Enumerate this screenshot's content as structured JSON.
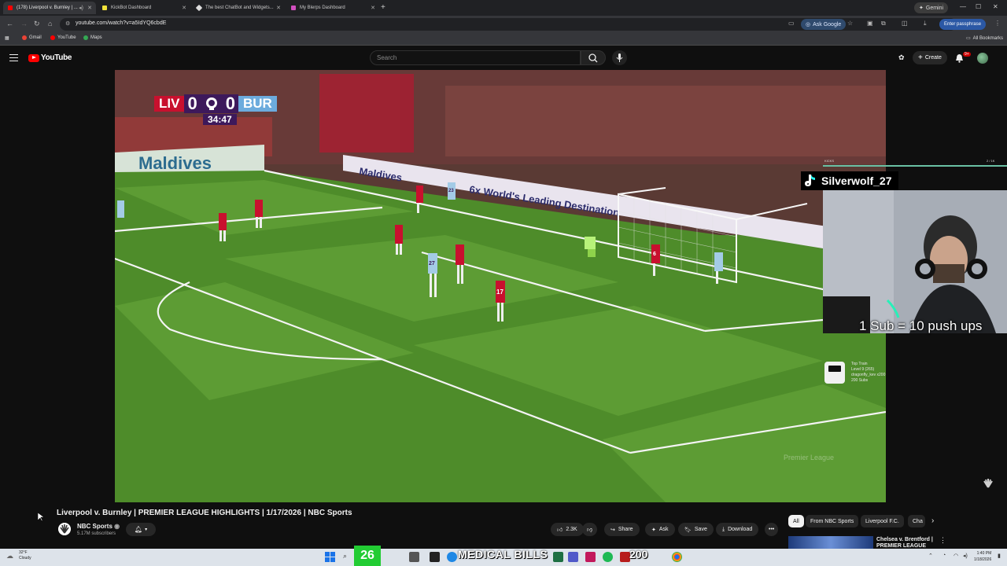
{
  "browser": {
    "tabs": [
      {
        "label": "(178) Liverpool v. Burnley | ...",
        "color": "#ff0000",
        "active": true
      },
      {
        "label": "KickBot Dashboard",
        "color": "#f2e33a",
        "active": false
      },
      {
        "label": "The best ChatBot and Widgets...",
        "color": "#dddddd",
        "active": false
      },
      {
        "label": "My Blerps Dashboard",
        "color": "#d14fbf",
        "active": false
      }
    ],
    "new_tab": "+",
    "gemini_label": "Gemini",
    "url": "youtube.com/watch?v=a5IdYQ6cbdE",
    "ask_google": "Ask Google",
    "passphrase": "Enter passphrase",
    "bookmarks": [
      "Gmail",
      "YouTube",
      "Maps"
    ],
    "all_bookmarks": "All Bookmarks"
  },
  "youtube": {
    "brand": "YouTube",
    "search_placeholder": "Search",
    "create_label": "Create",
    "notification_count": "9+"
  },
  "video": {
    "score_home": "LIV",
    "score_home_goals": "0",
    "score_away_goals": "0",
    "score_away": "BUR",
    "match_clock": "34:47",
    "board_text_1": "Maldives",
    "board_text_2": "6x World's Leading Destination",
    "jersey_numbers": [
      "6",
      "17",
      "27",
      "23"
    ],
    "watermark": "Premier League"
  },
  "overlay": {
    "bar_left": "KICKS",
    "bar_right": "2 / 1K",
    "tiktok_user": "Silverwolf_27",
    "pushups": "1 Sub = 10 push ups",
    "top_train_lines": [
      "Top Train",
      "Level 9 (265)",
      "dragonfly_kev x200",
      "200 Subs"
    ]
  },
  "details": {
    "title": "Liverpool v. Burnley | PREMIER LEAGUE HIGHLIGHTS | 1/17/2026 | NBC Sports",
    "channel": "NBC Sports",
    "subscribers": "5.17M subscribers",
    "likes": "2.3K",
    "share": "Share",
    "ask": "Ask",
    "save": "Save",
    "download": "Download"
  },
  "recommendations": {
    "chips": [
      "All",
      "From NBC Sports",
      "Liverpool F.C.",
      "Cha"
    ],
    "first_title_1": "Chelsea v. Brentford |",
    "first_title_2": "PREMIER LEAGUE"
  },
  "taskbar": {
    "temp": "32°F",
    "condition": "Cloudy",
    "banner_number": "26",
    "banner_text": "MEDICAL BILLS",
    "banner_goal": "200",
    "time": "1:40 PM",
    "date": "1/18/2026"
  }
}
